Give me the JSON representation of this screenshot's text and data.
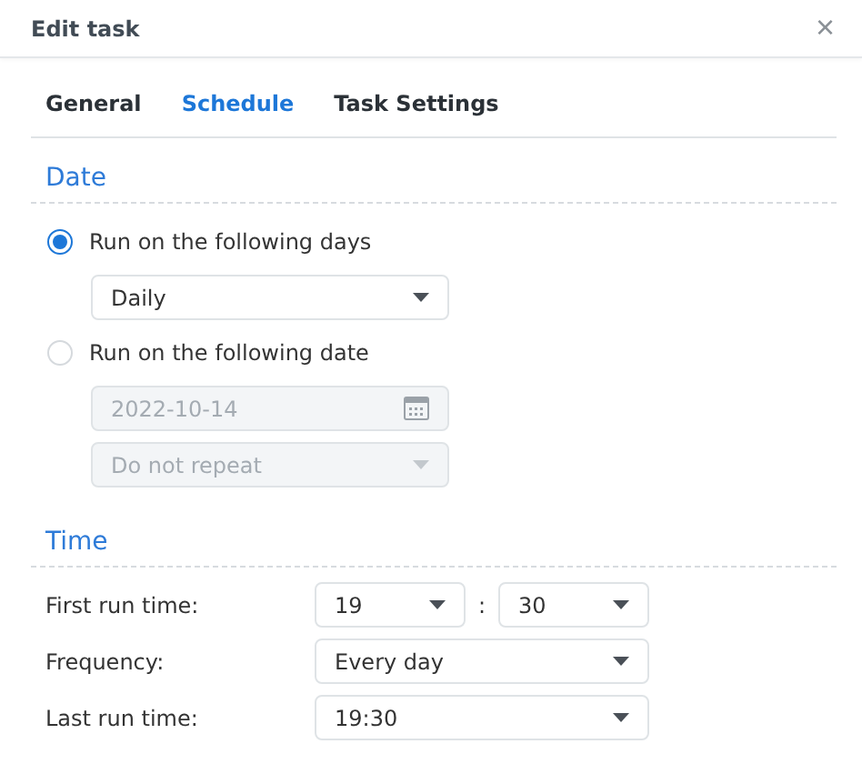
{
  "window": {
    "title": "Edit task",
    "close": "×"
  },
  "tabs": [
    {
      "label": "General",
      "selected": false
    },
    {
      "label": "Schedule",
      "selected": true
    },
    {
      "label": "Task Settings",
      "selected": false
    }
  ],
  "date": {
    "heading": "Date",
    "options": [
      {
        "label": "Run on the following days",
        "selected": true,
        "fields": [
          {
            "kind": "select",
            "value": "Daily",
            "disabled": false
          }
        ]
      },
      {
        "label": "Run on the following date",
        "selected": false,
        "fields": [
          {
            "kind": "date",
            "value": "2022-10-14",
            "disabled": true
          },
          {
            "kind": "select",
            "value": "Do not repeat",
            "disabled": true
          }
        ]
      }
    ]
  },
  "time": {
    "heading": "Time",
    "rows": [
      {
        "label": "First run time:",
        "kind": "time",
        "hour": "19",
        "separator": ":",
        "minute": "30"
      },
      {
        "label": "Frequency:",
        "kind": "select",
        "value": "Every day"
      },
      {
        "label": "Last run time:",
        "kind": "select",
        "value": "19:30"
      }
    ]
  }
}
